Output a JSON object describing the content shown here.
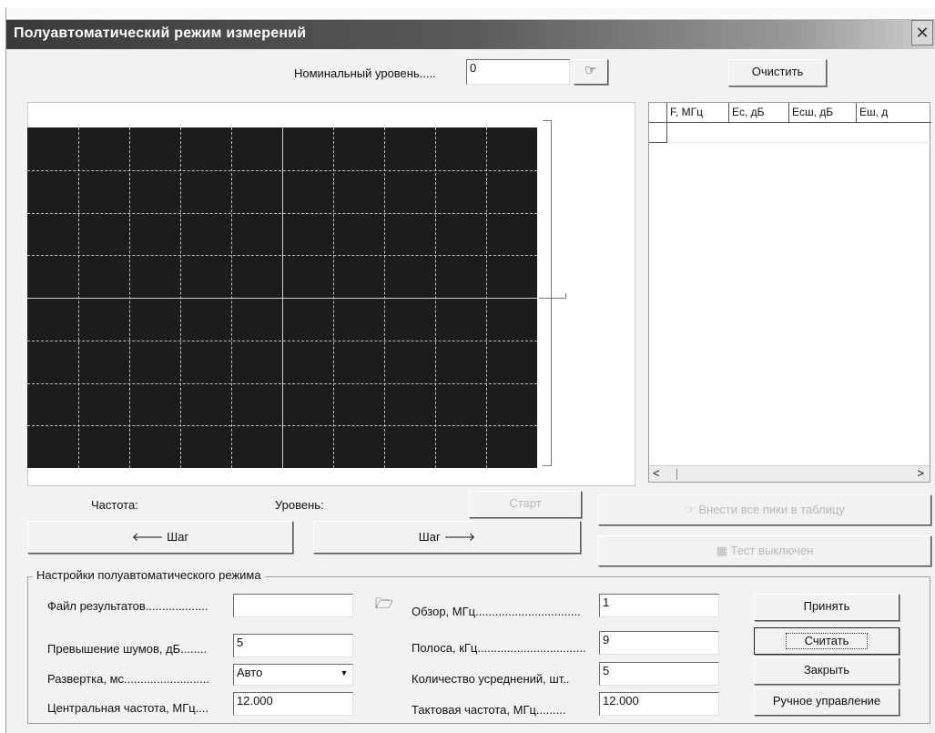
{
  "window": {
    "title": "Полуавтоматический режим измерений",
    "close_glyph": "✕"
  },
  "top": {
    "nominal_label": "Номинальный уровень.....",
    "nominal_value": "0",
    "apply_icon": "hand-pointer-icon",
    "clear_button": "Очистить"
  },
  "table": {
    "columns": [
      "F, МГц",
      "Ec, дБ",
      "Eсш, дБ",
      "Eш, д"
    ],
    "scroll_left": "<",
    "scroll_right": ">"
  },
  "readout": {
    "frequency_label": "Частота:",
    "level_label": "Уровень:",
    "start_button": "Старт",
    "add_peaks_button": "Внести все пики в таблицу",
    "step_back_button": "Шаг",
    "step_forward_button": "Шаг",
    "test_button": "Тест выключен"
  },
  "settings": {
    "group_title": "Настройки полуавтоматического режима",
    "results_file_label": "Файл результатов...................",
    "results_file_value": "",
    "noise_excess_label": "Превышение шумов, дБ........",
    "noise_excess_value": "5",
    "sweep_label": "Развертка, мс..........................",
    "sweep_value": "Авто",
    "center_freq_label": "Центральная частота, МГц....",
    "center_freq_value": "12.000",
    "span_label": "Обзор, МГц................................",
    "span_value": "1",
    "band_label": "Полоса, кГц.................................",
    "band_value": "9",
    "averaging_label": "Количество усреднений, шт..",
    "averaging_value": "5",
    "clock_freq_label": "Тактовая частота, МГц.........",
    "clock_freq_value": "12.000"
  },
  "buttons": {
    "accept": "Принять",
    "read": "Считать",
    "close": "Закрыть",
    "manual": "Ручное управление"
  },
  "colors": {
    "plot_background": "#1c1c1c",
    "grid": "#bfbfbf",
    "title_bar": "#3a3a3a"
  }
}
